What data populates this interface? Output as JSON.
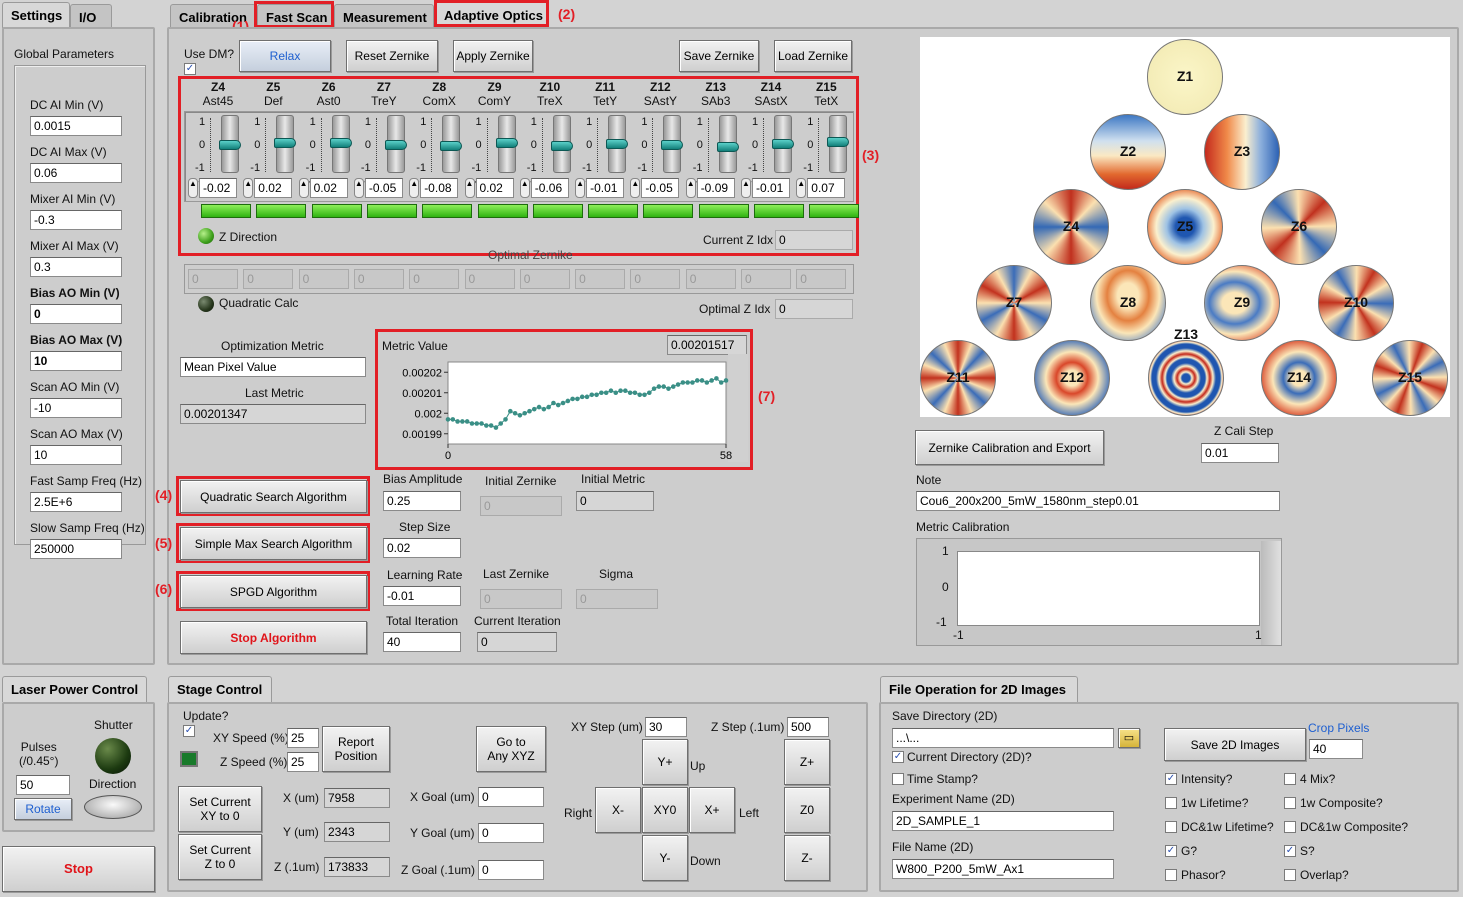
{
  "left_tabs": [
    "Settings",
    "I/O"
  ],
  "main_tabs": [
    "Calibration",
    "Fast Scan",
    "Measurement",
    "Adaptive Optics"
  ],
  "annotations": [
    "(1)",
    "(2)",
    "(3)",
    "(4)",
    "(5)",
    "(6)",
    "(7)"
  ],
  "global": {
    "title": "Global Parameters",
    "fields": [
      {
        "label": "DC AI Min (V)",
        "value": "0.0015",
        "bold": false
      },
      {
        "label": "DC AI Max (V)",
        "value": "0.06",
        "bold": false
      },
      {
        "label": "Mixer AI Min (V)",
        "value": "-0.3",
        "bold": false
      },
      {
        "label": "Mixer AI Max (V)",
        "value": "0.3",
        "bold": false
      },
      {
        "label": "Bias AO Min (V)",
        "value": "0",
        "bold": true
      },
      {
        "label": "Bias AO Max (V)",
        "value": "10",
        "bold": true
      },
      {
        "label": "Scan AO Min (V)",
        "value": "-10",
        "bold": false
      },
      {
        "label": "Scan AO Max (V)",
        "value": "10",
        "bold": false
      },
      {
        "label": "Fast Samp Freq (Hz)",
        "value": "2.5E+6",
        "bold": false
      },
      {
        "label": "Slow Samp Freq (Hz)",
        "value": "250000",
        "bold": false
      }
    ]
  },
  "ao": {
    "use_dm_label": "Use DM?",
    "use_dm_checked": "✓",
    "relax": "Relax",
    "reset": "Reset Zernike",
    "apply": "Apply Zernike",
    "save": "Save Zernike",
    "load": "Load Zernike",
    "zernikes": [
      {
        "z": "Z4",
        "name": "Ast45",
        "value": "-0.02",
        "level": 0.49
      },
      {
        "z": "Z5",
        "name": "Def",
        "value": "0.02",
        "level": 0.51
      },
      {
        "z": "Z6",
        "name": "Ast0",
        "value": "0.02",
        "level": 0.51
      },
      {
        "z": "Z7",
        "name": "TreY",
        "value": "-0.05",
        "level": 0.475
      },
      {
        "z": "Z8",
        "name": "ComX",
        "value": "-0.08",
        "level": 0.46
      },
      {
        "z": "Z9",
        "name": "ComY",
        "value": "0.02",
        "level": 0.51
      },
      {
        "z": "Z10",
        "name": "TreX",
        "value": "-0.06",
        "level": 0.47
      },
      {
        "z": "Z11",
        "name": "TetY",
        "value": "-0.01",
        "level": 0.495
      },
      {
        "z": "Z12",
        "name": "SAstY",
        "value": "-0.05",
        "level": 0.475
      },
      {
        "z": "Z13",
        "name": "SAb3",
        "value": "-0.09",
        "level": 0.455
      },
      {
        "z": "Z14",
        "name": "SAstX",
        "value": "-0.01",
        "level": 0.495
      },
      {
        "z": "Z15",
        "name": "TetX",
        "value": "0.07",
        "level": 0.535
      }
    ],
    "scale": [
      "1",
      "0",
      "-1"
    ],
    "z_direction": "Z Direction",
    "current_z_idx_label": "Current Z Idx",
    "current_z_idx": "0",
    "optimal_zernike": "Optimal Zernike",
    "optimal_values": [
      "0",
      "0",
      "0",
      "0",
      "0",
      "0",
      "0",
      "0",
      "0",
      "0",
      "0",
      "0"
    ],
    "quadratic_calc": "Quadratic Calc",
    "optimal_z_idx_label": "Optimal Z Idx",
    "optimal_z_idx": "0",
    "opt_metric_label": "Optimization Metric",
    "opt_metric": "Mean Pixel Value",
    "last_metric_label": "Last Metric",
    "last_metric": "0.00201347",
    "quad_btn": "Quadratic Search Algorithm",
    "simple_btn": "Simple Max Search Algorithm",
    "spgd_btn": "SPGD Algorithm",
    "stop_btn": "Stop Algorithm",
    "bias_amp_label": "Bias Amplitude",
    "bias_amp": "0.25",
    "init_zern_label": "Initial Zernike",
    "init_zern": "0",
    "init_metric_label": "Initial Metric",
    "init_metric": "0",
    "step_size_label": "Step Size",
    "step_size": "0.02",
    "lr_label": "Learning Rate",
    "lr": "-0.01",
    "last_zern_label": "Last Zernike",
    "last_zern": "0",
    "sigma_label": "Sigma",
    "sigma": "0",
    "total_iter_label": "Total Iteration",
    "total_iter": "40",
    "cur_iter_label": "Current Iteration",
    "cur_iter": "0"
  },
  "chart_data": {
    "type": "scatter",
    "title": "Metric Value",
    "readout": "0.00201517",
    "yticks": [
      "0.00202",
      "0.00201",
      "0.002",
      "0.00199"
    ],
    "xticks": [
      "0",
      "58"
    ],
    "xlim": [
      0,
      58
    ],
    "ylim": [
      0.001985,
      0.002025
    ],
    "color": "#3a8f86",
    "y": [
      0.001997,
      0.001997,
      0.001996,
      0.001996,
      0.001996,
      0.001995,
      0.001995,
      0.001995,
      0.001994,
      0.001994,
      0.001993,
      0.001995,
      0.001997,
      0.002001,
      0.002,
      0.001999,
      0.002,
      0.002001,
      0.002002,
      0.002003,
      0.002002,
      0.002003,
      0.002005,
      0.002004,
      0.002005,
      0.002006,
      0.002007,
      0.002007,
      0.002008,
      0.002008,
      0.002009,
      0.002009,
      0.00201,
      0.00201,
      0.002011,
      0.00201,
      0.002011,
      0.002011,
      0.00201,
      0.00201,
      0.002009,
      0.002009,
      0.00201,
      0.002012,
      0.002013,
      0.002013,
      0.002012,
      0.002013,
      0.002014,
      0.002015,
      0.002015,
      0.002015,
      0.002016,
      0.002016,
      0.002015,
      0.002016,
      0.002017,
      0.002015,
      0.002016
    ]
  },
  "zpanel": {
    "labels": [
      "Z1",
      "Z2",
      "Z3",
      "Z4",
      "Z5",
      "Z6",
      "Z7",
      "Z8",
      "Z9",
      "Z10",
      "Z11",
      "Z12",
      "Z13",
      "Z14",
      "Z15"
    ],
    "cal_btn": "Zernike Calibration and Export",
    "cali_step_label": "Z Cali Step",
    "cali_step": "0.01",
    "note_label": "Note",
    "note": "Cou6_200x200_5mW_1580nm_step0.01",
    "metric_cal_label": "Metric Calibration",
    "mc_y": [
      "1",
      "0",
      "-1"
    ],
    "mc_x": [
      "-1",
      "1"
    ]
  },
  "laser": {
    "title": "Laser Power Control",
    "shutter": "Shutter",
    "pulses": "Pulses\n(/0.45°)",
    "pulses_val": "50",
    "rotate": "Rotate",
    "direction": "Direction",
    "stop": "Stop"
  },
  "stage": {
    "title": "Stage Control",
    "update": "Update?",
    "xy_speed_label": "XY Speed (%)",
    "xy_speed": "25",
    "z_speed_label": "Z Speed (%)",
    "z_speed": "25",
    "report": "Report\nPosition",
    "goto": "Go to\nAny XYZ",
    "set_xy": "Set Current\nXY to 0",
    "set_z": "Set Current\nZ to 0",
    "x_label": "X (um)",
    "x": "7958",
    "y_label": "Y (um)",
    "y": "2343",
    "z_label": "Z (.1um)",
    "z": "173833",
    "xg_label": "X Goal (um)",
    "xg": "0",
    "yg_label": "Y Goal (um)",
    "yg": "0",
    "zg_label": "Z Goal (.1um)",
    "zg": "0",
    "xy_step_label": "XY Step (um)",
    "xy_step": "30",
    "z_step_label": "Z Step (.1um)",
    "z_step": "500",
    "yp": "Y+",
    "ym": "Y-",
    "xm": "X-",
    "xp": "X+",
    "xy0": "XY0",
    "zp": "Z+",
    "z0": "Z0",
    "zm": "Z-",
    "up": "Up",
    "down": "Down",
    "right": "Right",
    "left": "Left"
  },
  "file": {
    "title": "File Operation for 2D Images",
    "save_dir_label": "Save Directory (2D)",
    "save_dir": "...\\...",
    "cur_dir": "Current Directory (2D)?",
    "time_stamp": "Time Stamp?",
    "exp_label": "Experiment Name (2D)",
    "exp": "2D_SAMPLE_1",
    "fname_label": "File Name (2D)",
    "fname": "W800_P200_5mW_Ax1",
    "save_btn": "Save 2D Images",
    "crop_label": "Crop Pixels",
    "crop": "40",
    "checks": [
      {
        "label": "Intensity?",
        "on": "✓"
      },
      {
        "label": "4 Mix?",
        "on": ""
      },
      {
        "label": "1w Lifetime?",
        "on": ""
      },
      {
        "label": "1w Composite?",
        "on": ""
      },
      {
        "label": "DC&1w Lifetime?",
        "on": ""
      },
      {
        "label": "DC&1w Composite?",
        "on": ""
      },
      {
        "label": "G?",
        "on": "✓"
      },
      {
        "label": "S?",
        "on": "✓"
      },
      {
        "label": "Phasor?",
        "on": ""
      },
      {
        "label": "Overlap?",
        "on": ""
      }
    ]
  }
}
